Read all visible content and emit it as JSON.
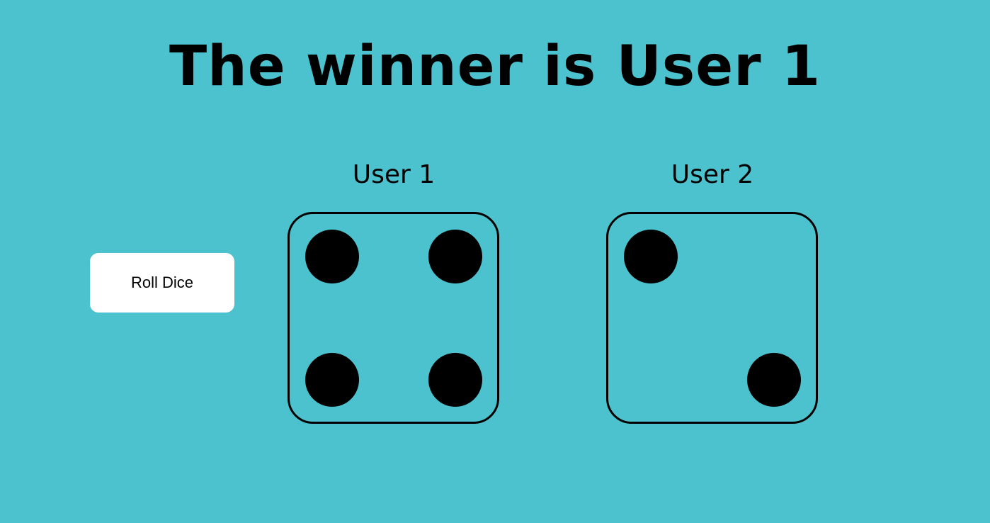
{
  "title": "The winner is User 1",
  "roll_button_label": "Roll Dice",
  "players": [
    {
      "label": "User 1",
      "die_value": 4
    },
    {
      "label": "User 2",
      "die_value": 2
    }
  ],
  "colors": {
    "background": "#4cc2ce",
    "button": "#ffffff",
    "pip": "#000000"
  }
}
